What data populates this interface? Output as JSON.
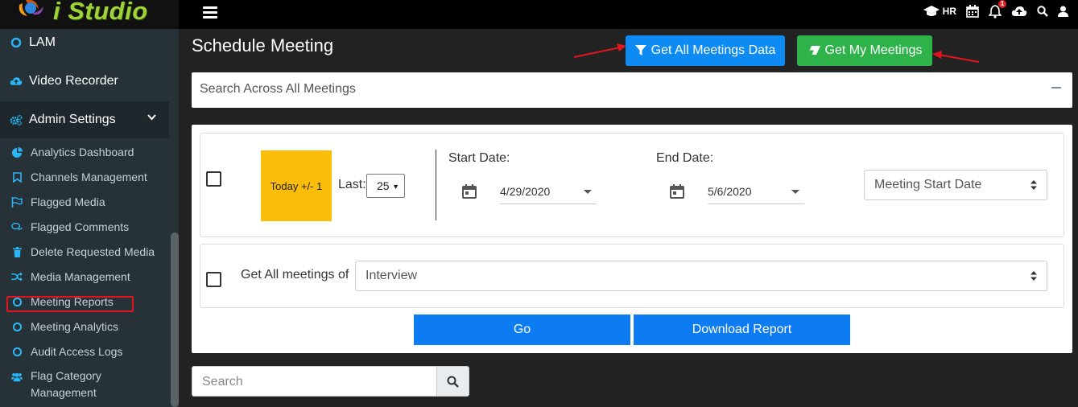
{
  "app": {
    "logo_text": "i Studio"
  },
  "topbar": {
    "user_role": "HR",
    "notification_count": "1"
  },
  "sidebar": {
    "main_items": [
      {
        "label": "LAM",
        "icon": "circle-outline-icon"
      },
      {
        "label": "Video Recorder",
        "icon": "cloud-upload-icon"
      },
      {
        "label": "Admin Settings",
        "icon": "cogs-icon"
      }
    ],
    "admin_items": [
      {
        "label": "Analytics Dashboard",
        "icon": "pie-chart-icon"
      },
      {
        "label": "Channels Management",
        "icon": "bookmark-icon"
      },
      {
        "label": "Flagged Media",
        "icon": "flag-icon"
      },
      {
        "label": "Flagged Comments",
        "icon": "comments-icon"
      },
      {
        "label": "Delete Requested Media",
        "icon": "trash-icon"
      },
      {
        "label": "Media Management",
        "icon": "random-icon"
      },
      {
        "label": "Meeting Reports",
        "icon": "circle-outline-icon"
      },
      {
        "label": "Meeting Analytics",
        "icon": "circle-outline-icon"
      },
      {
        "label": "Audit Access Logs",
        "icon": "circle-outline-icon"
      },
      {
        "label": "Flag Category Management",
        "icon": "users-icon"
      }
    ]
  },
  "main": {
    "title": "Schedule Meeting",
    "get_all_label": "Get All Meetings Data",
    "get_my_label": "Get My Meetings",
    "search_panel_label": "Search Across All Meetings",
    "today_label": "Today +/- 1",
    "last_label": "Last:",
    "last_value": "25",
    "start_date_label": "Start Date:",
    "start_date_value": "4/29/2020",
    "end_date_label": "End Date:",
    "end_date_value": "5/6/2020",
    "sort_select_value": "Meeting Start Date",
    "get_all_meetings_of_label": "Get All meetings of",
    "meeting_type_value": "Interview",
    "go_label": "Go",
    "download_label": "Download Report",
    "search_placeholder": "Search"
  },
  "colors": {
    "accent_blue": "#0d8bf2",
    "accent_green": "#2db34a",
    "today_yellow": "#fbbd0a",
    "sidebar_bg": "#263238",
    "annotation_red": "#e0151e"
  }
}
